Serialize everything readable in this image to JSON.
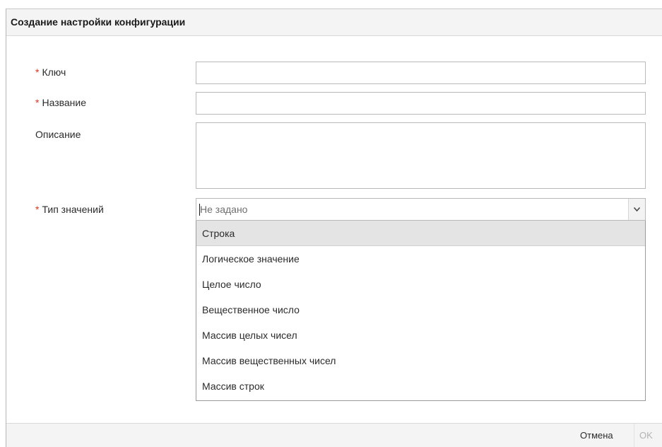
{
  "dialog": {
    "title": "Создание настройки конфигурации"
  },
  "form": {
    "required_mark": "*",
    "key": {
      "label": "Ключ",
      "value": "",
      "required": true
    },
    "name": {
      "label": "Название",
      "value": "",
      "required": true
    },
    "description": {
      "label": "Описание",
      "value": "",
      "required": false
    },
    "value_type": {
      "label": "Тип значений",
      "placeholder": "Не задано",
      "required": true,
      "dropdown_open": true,
      "highlighted_index": 0,
      "options": [
        "Строка",
        "Логическое значение",
        "Целое число",
        "Вещественное число",
        "Массив целых чисел",
        "Массив вещественных чисел",
        "Массив строк"
      ]
    }
  },
  "footer": {
    "cancel_label": "Отмена",
    "ok_label": "OK",
    "ok_enabled": false
  },
  "colors": {
    "required_mark": "#e0321c",
    "highlight_bg": "#e4e4e4",
    "panel_bg": "#f4f4f4",
    "disabled_text": "#b3b3b3"
  },
  "icons": {
    "combo_trigger": "chevron-down-icon"
  }
}
